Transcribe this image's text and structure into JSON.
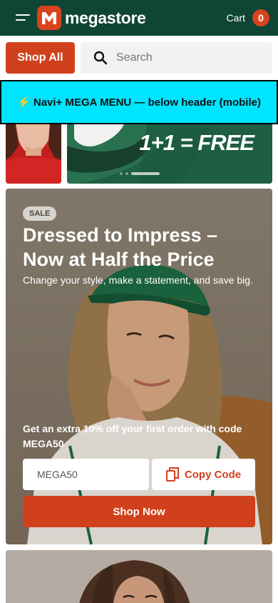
{
  "header": {
    "logo_letter": "M",
    "logo_text": "megastore",
    "cart_label": "Cart",
    "cart_count": "0"
  },
  "toolbar": {
    "shop_all_label": "Shop All",
    "search_placeholder": "Search"
  },
  "mega_menu": {
    "label": "⚡ Navi+ MEGA MENU — below header (mobile)"
  },
  "carousel": {
    "promo_text": "1+1 = FREE",
    "slide_count": 3,
    "active_slide": 3
  },
  "hero": {
    "badge": "SALE",
    "title": "Dressed to Impress – Now at Half the Price",
    "subtitle": "Change your style, make a statement, and save big.",
    "offer_text": "Get an extra 10% off your first order with code MEGA50",
    "code_value": "MEGA50",
    "copy_label": "Copy Code",
    "cta_label": "Shop Now"
  },
  "colors": {
    "header_bg": "#0f4535",
    "accent": "#d1401c",
    "mega_bg": "#00e5ff"
  },
  "icons": [
    "menu-icon",
    "search-icon",
    "copy-icon"
  ]
}
